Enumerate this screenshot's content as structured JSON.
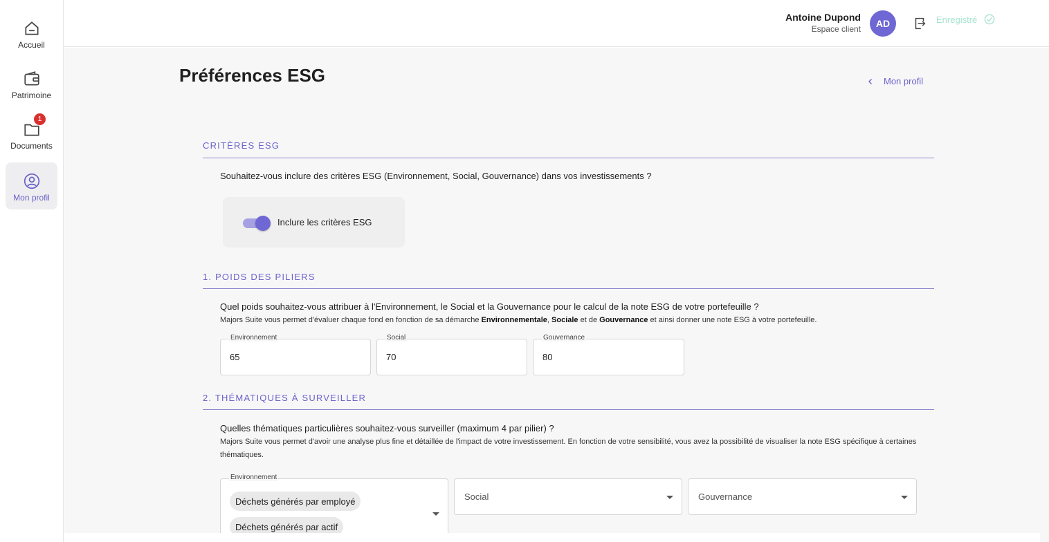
{
  "sidebar": {
    "items": [
      {
        "label": "Accueil",
        "icon": "home-icon"
      },
      {
        "label": "Patrimoine",
        "icon": "wallet-icon"
      },
      {
        "label": "Documents",
        "icon": "folder-icon",
        "badge": "1"
      },
      {
        "label": "Mon profil",
        "icon": "user-circle-icon",
        "active": true
      }
    ]
  },
  "header": {
    "user_name": "Antoine Dupond",
    "user_subtitle": "Espace client",
    "avatar_initials": "AD",
    "saved_label": "Enregistré"
  },
  "page": {
    "title": "Préférences ESG",
    "back_label": "Mon profil"
  },
  "criteria": {
    "section_title": "CRITÈRES ESG",
    "question": "Souhaitez-vous inclure des critères ESG (Environnement, Social, Gouvernance) dans vos investissements ?",
    "toggle_label": "Inclure les critères ESG",
    "toggle_on": true
  },
  "weights": {
    "section_title": "1. POIDS DES PILIERS",
    "question": "Quel poids souhaitez-vous attribuer à l'Environnement, le Social et la Gouvernance pour le calcul de la note ESG de votre portefeuille ?",
    "helper_prefix": "Majors Suite vous permet d'évaluer chaque fond en fonction de sa démarche ",
    "helper_env": "Environnementale",
    "helper_comma": ", ",
    "helper_soc": "Sociale",
    "helper_and": " et de ",
    "helper_gov": "Gouvernance",
    "helper_suffix": " et ainsi donner une note ESG à votre portefeuille.",
    "fields": [
      {
        "label": "Environnement",
        "value": "65"
      },
      {
        "label": "Social",
        "value": "70"
      },
      {
        "label": "Gouvernance",
        "value": "80"
      }
    ]
  },
  "themes": {
    "section_title": "2. THÉMATIQUES À SURVEILLER",
    "question": "Quelles thématiques particulières souhaitez-vous surveiller (maximum 4 par pilier) ?",
    "helper": "Majors Suite vous permet d'avoir une analyse plus fine et détaillée de l'impact de votre investissement. En fonction de votre sensibilité, vous avez la possibilité de visualiser la note ESG spécifique à certaines thématiques.",
    "environment": {
      "label": "Environnement",
      "chips": [
        "Déchets générés par employé",
        "Déchets générés par actif"
      ]
    },
    "social_placeholder": "Social",
    "governance_placeholder": "Gouvernance"
  },
  "colors": {
    "accent": "#6b63c9",
    "avatar": "#6f67d4",
    "badge": "#d9302f",
    "saved": "#a6e3cf"
  }
}
